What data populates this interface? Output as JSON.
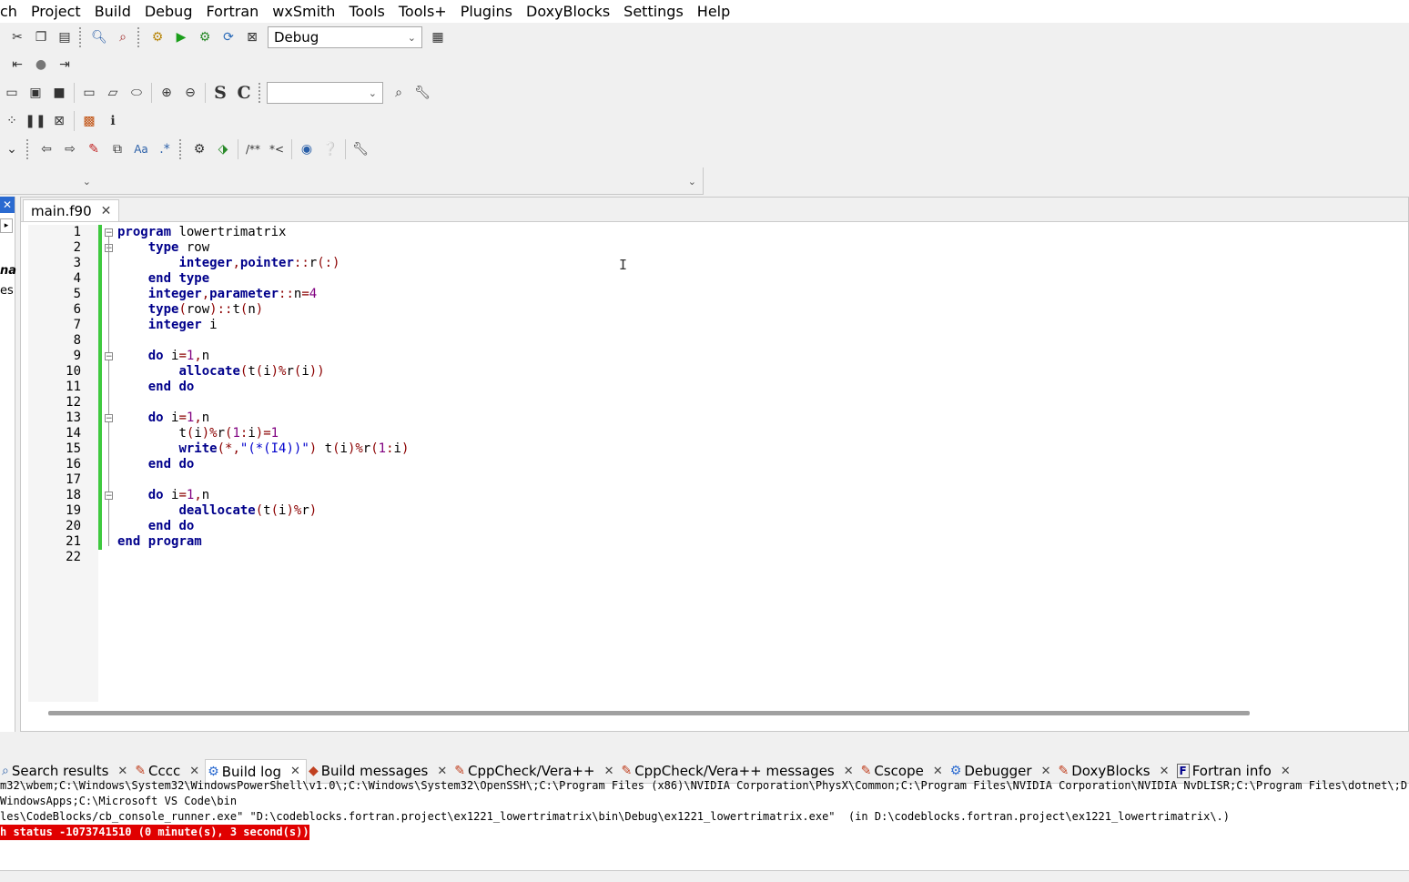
{
  "menu": [
    "ch",
    "Project",
    "Build",
    "Debug",
    "Fortran",
    "wxSmith",
    "Tools",
    "Tools+",
    "Plugins",
    "DoxyBlocks",
    "Settings",
    "Help"
  ],
  "toolbar": {
    "build_target": "Debug",
    "search_combo_value": ""
  },
  "editor": {
    "tab_label": "main.f90",
    "line_numbers": [
      "1",
      "2",
      "3",
      "4",
      "5",
      "6",
      "7",
      "8",
      "9",
      "10",
      "11",
      "12",
      "13",
      "14",
      "15",
      "16",
      "17",
      "18",
      "19",
      "20",
      "21",
      "22"
    ],
    "lines": [
      "program lowertrimatrix",
      "    type row",
      "        integer,pointer::r(:)",
      "    end type",
      "    integer,parameter::n=4",
      "    type(row)::t(n)",
      "    integer i",
      "",
      "    do i=1,n",
      "        allocate(t(i)%r(i))",
      "    end do",
      "",
      "    do i=1,n",
      "        t(i)%r(1:i)=1",
      "        write(*,\"(*(I4))\") t(i)%r(1:i)",
      "    end do",
      "",
      "    do i=1,n",
      "        deallocate(t(i)%r)",
      "    end do",
      "end program",
      ""
    ]
  },
  "left_panel_fragments": [
    "na",
    "es"
  ],
  "bottom_tabs": [
    {
      "label": "Search results",
      "icon": "search-icon"
    },
    {
      "label": "Cccc",
      "icon": "pencil-icon"
    },
    {
      "label": "Build log",
      "icon": "gear-icon"
    },
    {
      "label": "Build messages",
      "icon": "diamond-icon"
    },
    {
      "label": "CppCheck/Vera++",
      "icon": "pencil-icon"
    },
    {
      "label": "CppCheck/Vera++ messages",
      "icon": "pencil-icon"
    },
    {
      "label": "Cscope",
      "icon": "pencil-icon"
    },
    {
      "label": "Debugger",
      "icon": "gear-icon"
    },
    {
      "label": "DoxyBlocks",
      "icon": "pencil-icon"
    },
    {
      "label": "Fortran info",
      "icon": "fortran-icon"
    }
  ],
  "build_log": {
    "line1": "m32\\wbem;C:\\Windows\\System32\\WindowsPowerShell\\v1.0\\;C:\\Windows\\System32\\OpenSSH\\;C:\\Program Files (x86)\\NVIDIA Corporation\\PhysX\\Common;C:\\Program Files\\NVIDIA Corporation\\NVIDIA NvDLISR;C:\\Program Files\\dotnet\\;D:\\matlab\\b",
    "line2": "WindowsApps;C:\\Microsoft VS Code\\bin",
    "line3": "les\\CodeBlocks/cb_console_runner.exe\" \"D:\\codeblocks.fortran.project\\ex1221_lowertrimatrix\\bin\\Debug\\ex1221_lowertrimatrix.exe\"  (in D:\\codeblocks.fortran.project\\ex1221_lowertrimatrix\\.)",
    "line4": "h status -1073741510 (0 minute(s), 3 second(s))"
  },
  "colors": {
    "keyword": "#00008b",
    "operator": "#8b0000",
    "number": "#800080",
    "string": "#0000cc",
    "change_bar": "#3ec93e",
    "error_bg": "#e00000"
  }
}
